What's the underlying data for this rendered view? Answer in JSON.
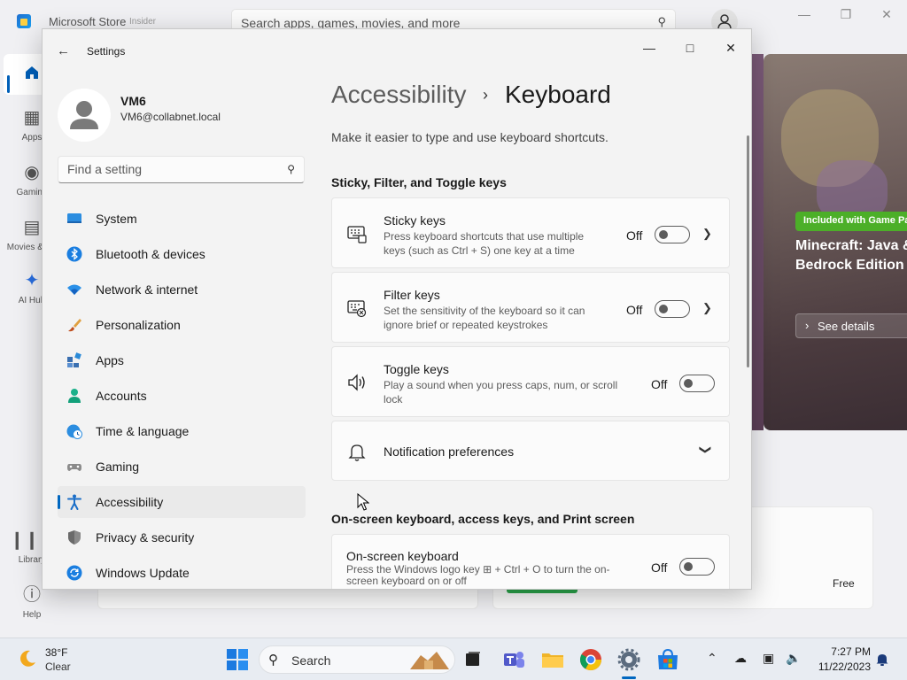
{
  "store": {
    "title": "Microsoft Store",
    "insider": "Insider",
    "search_placeholder": "Search apps, games, movies, and more",
    "nav": [
      {
        "label": "",
        "icon": "home-icon"
      },
      {
        "label": "Apps",
        "icon": "apps-icon"
      },
      {
        "label": "Gaming",
        "icon": "gamepad-icon"
      },
      {
        "label": "Movies & TV",
        "icon": "film-icon"
      },
      {
        "label": "AI Hub",
        "icon": "sparkle-icon"
      },
      {
        "label": "Library",
        "icon": "library-icon"
      },
      {
        "label": "Help",
        "icon": "help-icon"
      }
    ],
    "hero": {
      "badge": "Included with Game Pass",
      "title": "Minecraft: Java & Bedrock Edition for PC",
      "button": "See details"
    },
    "free_label": "Free"
  },
  "settings": {
    "window_title": "Settings",
    "profile": {
      "name": "VM6",
      "email": "VM6@collabnet.local"
    },
    "search_placeholder": "Find a setting",
    "nav": [
      {
        "label": "System",
        "icon": "system-icon"
      },
      {
        "label": "Bluetooth & devices",
        "icon": "bluetooth-icon"
      },
      {
        "label": "Network & internet",
        "icon": "wifi-icon"
      },
      {
        "label": "Personalization",
        "icon": "brush-icon"
      },
      {
        "label": "Apps",
        "icon": "apps-icon"
      },
      {
        "label": "Accounts",
        "icon": "person-icon"
      },
      {
        "label": "Time & language",
        "icon": "globe-clock-icon"
      },
      {
        "label": "Gaming",
        "icon": "controller-icon"
      },
      {
        "label": "Accessibility",
        "icon": "accessibility-icon",
        "active": true
      },
      {
        "label": "Privacy & security",
        "icon": "shield-icon"
      },
      {
        "label": "Windows Update",
        "icon": "update-icon"
      }
    ],
    "breadcrumb": {
      "parent": "Accessibility",
      "separator": "›",
      "current": "Keyboard"
    },
    "description": "Make it easier to type and use keyboard shortcuts.",
    "section1": "Sticky, Filter, and Toggle keys",
    "cards": [
      {
        "title": "Sticky keys",
        "desc1": "Press keyboard shortcuts that use multiple",
        "desc2": "keys (such as Ctrl + S) one key at a time",
        "state": "Off",
        "icon": "sticky-keys-icon"
      },
      {
        "title": "Filter keys",
        "desc1": "Set the sensitivity of the keyboard so it can",
        "desc2": "ignore brief or repeated keystrokes",
        "state": "Off",
        "icon": "filter-keys-icon"
      },
      {
        "title": "Toggle keys",
        "desc1": "Play a sound when you press caps, num, or scroll",
        "desc2": "lock",
        "state": "Off",
        "icon": "speaker-icon"
      }
    ],
    "notification": {
      "title": "Notification preferences",
      "icon": "bell-icon"
    },
    "section2": "On-screen keyboard, access keys, and Print screen",
    "osk": {
      "title": "On-screen keyboard",
      "desc1": "Press the Windows logo key ⊞ + Ctrl + O to turn the on-",
      "desc2": "screen keyboard on or off",
      "state": "Off"
    }
  },
  "taskbar": {
    "weather": {
      "temp": "38°F",
      "condition": "Clear"
    },
    "search_label": "Search",
    "time": "7:27 PM",
    "date": "11/22/2023"
  },
  "colors": {
    "accent": "#0067c0",
    "badge_green": "#4caf28"
  }
}
